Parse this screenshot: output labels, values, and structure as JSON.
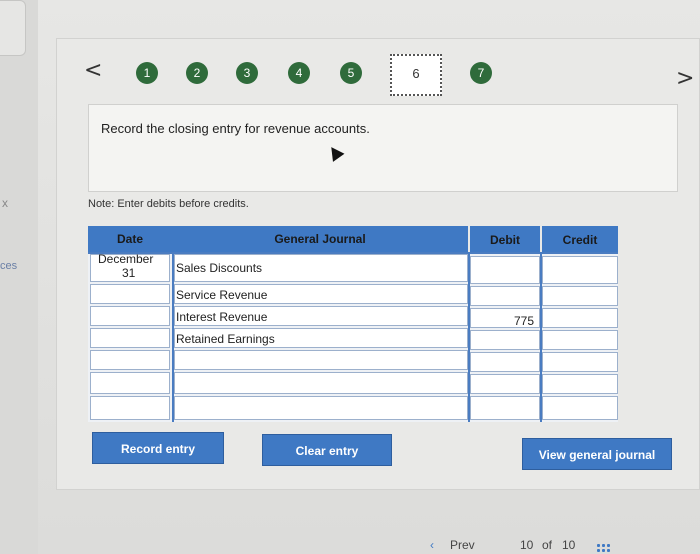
{
  "nav": {
    "steps": [
      "1",
      "2",
      "3",
      "4",
      "5",
      "6",
      "7"
    ],
    "current_step": "6",
    "prev_arrow": "<",
    "next_arrow": ">"
  },
  "question": {
    "text": "Record the closing entry for revenue accounts."
  },
  "note": "Note: Enter debits before credits.",
  "journal": {
    "headers": {
      "date": "Date",
      "general_journal": "General Journal",
      "debit": "Debit",
      "credit": "Credit"
    },
    "date_month": "December",
    "date_day": "31",
    "rows": [
      {
        "account": "Sales Discounts",
        "debit": "",
        "credit": ""
      },
      {
        "account": "Service Revenue",
        "debit": "",
        "credit": ""
      },
      {
        "account": "Interest Revenue",
        "debit": "775",
        "credit": ""
      },
      {
        "account": "Retained Earnings",
        "debit": "",
        "credit": ""
      },
      {
        "account": "",
        "debit": "",
        "credit": ""
      },
      {
        "account": "",
        "debit": "",
        "credit": ""
      },
      {
        "account": "",
        "debit": "",
        "credit": ""
      }
    ]
  },
  "buttons": {
    "record": "Record entry",
    "clear": "Clear entry",
    "view": "View general journal"
  },
  "sidebar": {
    "close": "x",
    "label": "ces"
  },
  "footer": {
    "prev": "Prev",
    "page": "10",
    "of": "of",
    "total": "10"
  },
  "colors": {
    "step_green": "#2f6b3b",
    "header_blue": "#3f79c4"
  }
}
